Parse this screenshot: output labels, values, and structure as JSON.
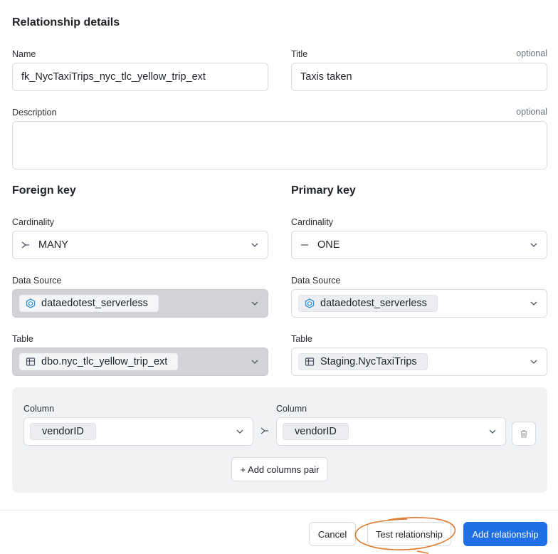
{
  "header": {
    "title": "Relationship details"
  },
  "name": {
    "label": "Name",
    "value": "fk_NycTaxiTrips_nyc_tlc_yellow_trip_ext"
  },
  "title_field": {
    "label": "Title",
    "optional": "optional",
    "value": "Taxis taken"
  },
  "description": {
    "label": "Description",
    "optional": "optional",
    "value": ""
  },
  "foreign_key": {
    "heading": "Foreign key",
    "cardinality_label": "Cardinality",
    "cardinality_value": "MANY",
    "cardinality_icon": "crow-foot-many-icon",
    "datasource_label": "Data Source",
    "datasource_value": "dataedotest_serverless",
    "table_label": "Table",
    "table_value": "dbo.nyc_tlc_yellow_trip_ext"
  },
  "primary_key": {
    "heading": "Primary key",
    "cardinality_label": "Cardinality",
    "cardinality_value": "ONE",
    "cardinality_icon": "line-one-icon",
    "datasource_label": "Data Source",
    "datasource_value": "dataedotest_serverless",
    "table_label": "Table",
    "table_value": "Staging.NycTaxiTrips"
  },
  "columns": {
    "left_label": "Column",
    "right_label": "Column",
    "left_value": "vendorID",
    "right_value": "vendorID",
    "add_pair_label": "+ Add columns pair"
  },
  "footer": {
    "cancel_label": "Cancel",
    "test_label": "Test relationship",
    "add_label": "Add relationship"
  },
  "colors": {
    "accent": "#1f6fe5",
    "annotation": "#e07a2e",
    "disabled_bg": "#d2d3d6"
  }
}
